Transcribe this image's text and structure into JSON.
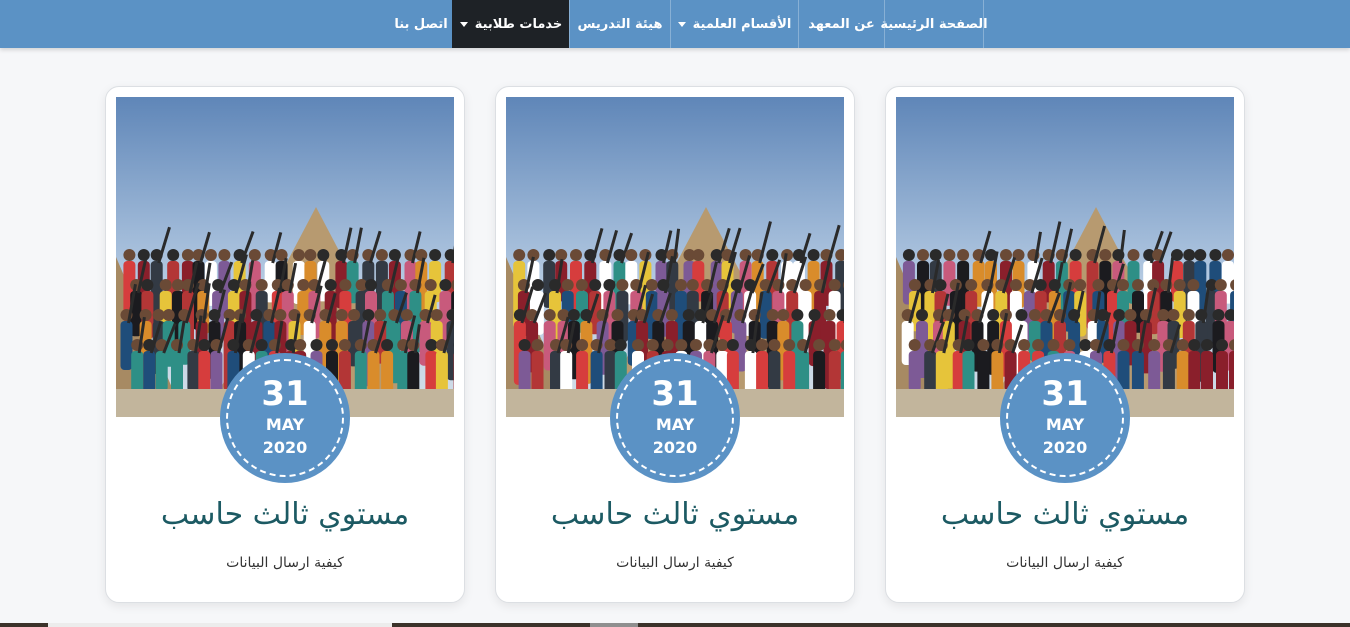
{
  "nav": {
    "items": [
      {
        "label": "الصفحة الرئيسية",
        "dropdown": false,
        "active": false
      },
      {
        "label": "عن المعهد",
        "dropdown": false,
        "active": false
      },
      {
        "label": "الأقسام العلمية",
        "dropdown": true,
        "active": false
      },
      {
        "label": "هيئة التدريس",
        "dropdown": false,
        "active": false
      },
      {
        "label": "خدمات طلابية",
        "dropdown": true,
        "active": true
      },
      {
        "label": "اتصل بنا",
        "dropdown": false,
        "active": false
      }
    ]
  },
  "colors": {
    "accent": "#5b92c5",
    "nav_active": "#1e2226",
    "title": "#1c5a63"
  },
  "cards": [
    {
      "day": "31",
      "month": "MAY",
      "year": "2020",
      "title": "مستوي ثالث حاسب",
      "subtitle": "كيفية ارسال البيانات",
      "image": "students-group-photo"
    },
    {
      "day": "31",
      "month": "MAY",
      "year": "2020",
      "title": "مستوي ثالث حاسب",
      "subtitle": "كيفية ارسال البيانات",
      "image": "students-group-photo"
    },
    {
      "day": "31",
      "month": "MAY",
      "year": "2020",
      "title": "مستوي ثالث حاسب",
      "subtitle": "كيفية ارسال البيانات",
      "image": "students-group-photo"
    }
  ]
}
